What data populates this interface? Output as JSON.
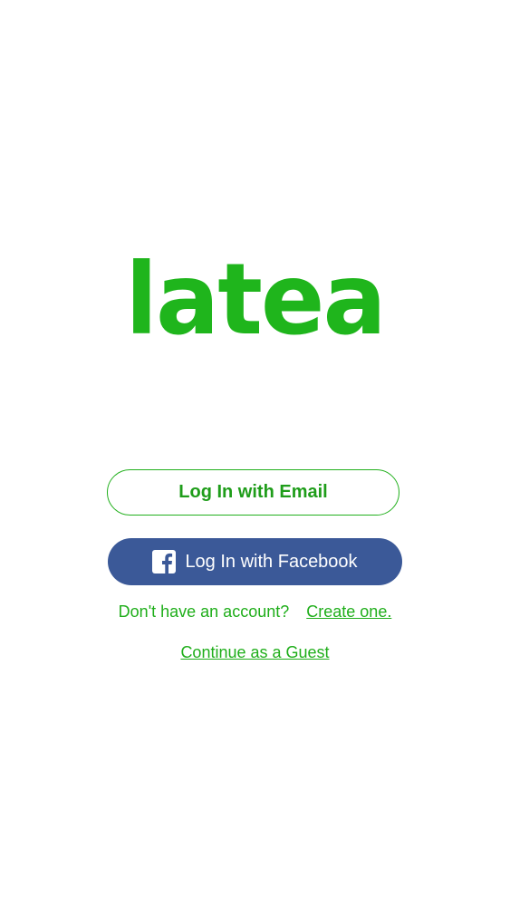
{
  "logo": {
    "text": "latea"
  },
  "login": {
    "email_button_label": "Log In with Email",
    "facebook_button_label": "Log In with Facebook",
    "facebook_icon": "facebook-icon"
  },
  "signup": {
    "prompt": "Don't have an account?",
    "link_label": "Create one."
  },
  "guest": {
    "link_label": "Continue as a Guest"
  },
  "colors": {
    "brand_green": "#1fb51c",
    "facebook_blue": "#3b5998",
    "background": "#ffffff"
  }
}
